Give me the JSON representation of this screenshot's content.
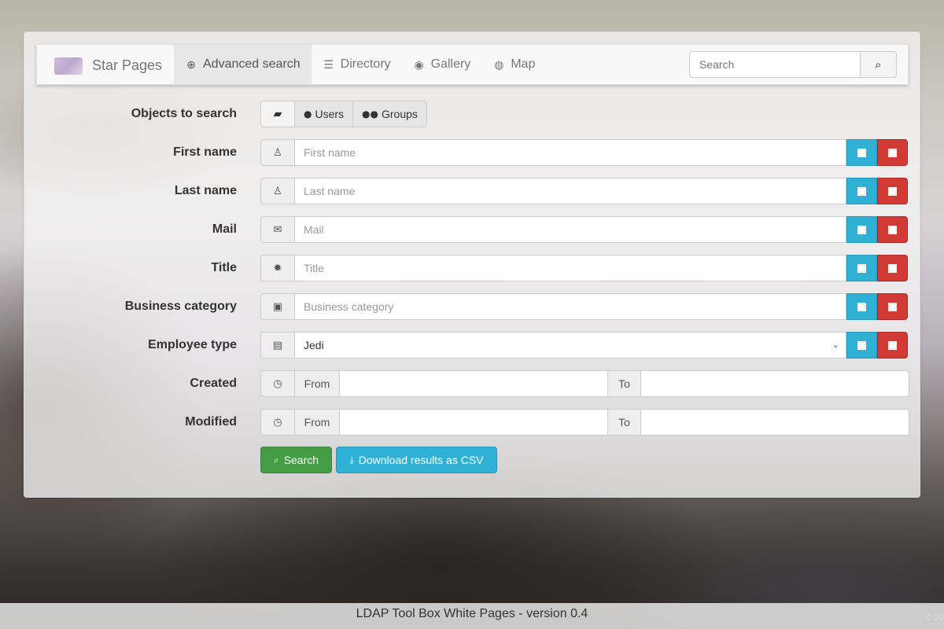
{
  "navbar": {
    "brand": "Star Pages",
    "items": [
      {
        "label": "Advanced search",
        "icon": "search-plus-icon",
        "active": true
      },
      {
        "label": "Directory",
        "icon": "list-icon"
      },
      {
        "label": "Gallery",
        "icon": "user-circle-icon"
      },
      {
        "label": "Map",
        "icon": "globe-icon"
      }
    ],
    "search_placeholder": "Search"
  },
  "form": {
    "objects": {
      "label": "Objects to search",
      "options": [
        "Users",
        "Groups"
      ]
    },
    "fields": [
      {
        "label": "First name",
        "placeholder": "First name",
        "icon": "user-icon"
      },
      {
        "label": "Last name",
        "placeholder": "Last name",
        "icon": "user-icon"
      },
      {
        "label": "Mail",
        "placeholder": "Mail",
        "icon": "envelope-icon"
      },
      {
        "label": "Title",
        "placeholder": "Title",
        "icon": "certificate-icon"
      },
      {
        "label": "Business category",
        "placeholder": "Business category",
        "icon": "briefcase-icon"
      }
    ],
    "employee_type": {
      "label": "Employee type",
      "value": "Jedi"
    },
    "created": {
      "label": "Created",
      "from": "From",
      "to": "To"
    },
    "modified": {
      "label": "Modified",
      "from": "From",
      "to": "To"
    },
    "buttons": {
      "search": "Search",
      "download": "Download results as CSV"
    }
  },
  "footer": {
    "text": "LDAP Tool Box White Pages - version 0.4",
    "copyright": "© 20"
  },
  "colors": {
    "blue": "#31b0d5",
    "red": "#d23a36",
    "green": "#449d44"
  }
}
